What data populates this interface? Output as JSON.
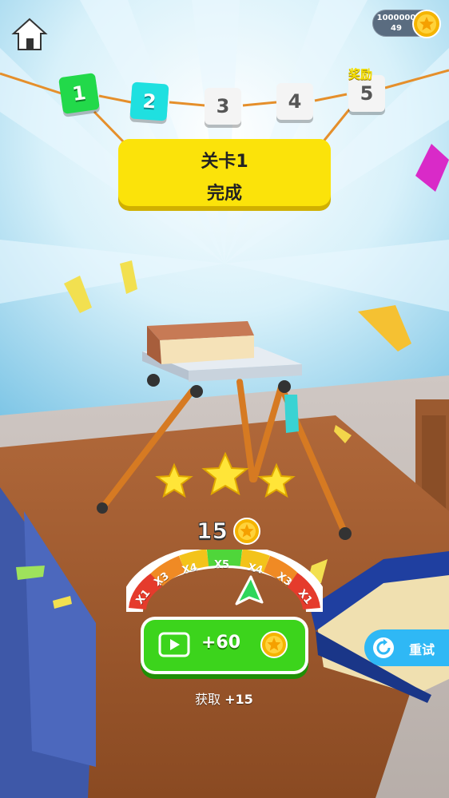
{
  "coins": {
    "total": "1000000",
    "sub": "49"
  },
  "levels": [
    {
      "number": "1",
      "state": "completed"
    },
    {
      "number": "2",
      "state": "current"
    },
    {
      "number": "3",
      "state": "locked"
    },
    {
      "number": "4",
      "state": "locked"
    },
    {
      "number": "5",
      "state": "reward"
    }
  ],
  "reward_level_label": "奖励",
  "banner": {
    "line1": "关卡1",
    "line2": "完成"
  },
  "stars": {
    "earned": 3,
    "total": 3
  },
  "reward_amount": "15",
  "multiplier": {
    "labels": [
      "X1",
      "X3",
      "X4",
      "X5",
      "X4",
      "X3",
      "X1"
    ],
    "pointer_index": 4
  },
  "video_button": {
    "amount": "+60"
  },
  "retry_button": {
    "label": "重试"
  },
  "claim": {
    "prefix": "获取 ",
    "amount": "+15"
  },
  "colors": {
    "banner": "#fbe30a",
    "video_button": "#3cd41c",
    "retry_button": "#2fb8f5",
    "level_done": "#22d94a",
    "level_current": "#1fe0e0"
  }
}
